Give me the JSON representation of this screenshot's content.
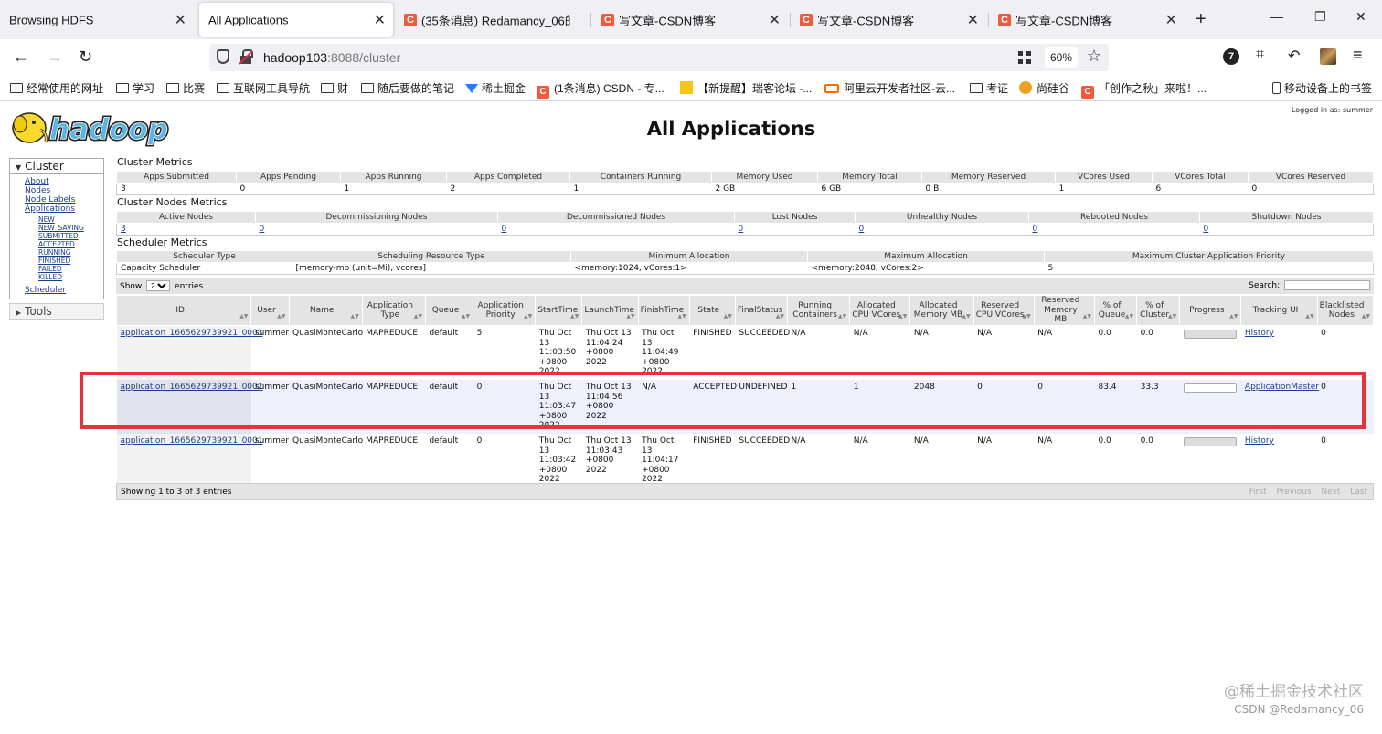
{
  "browser": {
    "tabs": [
      {
        "label": "Browsing HDFS",
        "icon": ""
      },
      {
        "label": "All Applications",
        "icon": ""
      },
      {
        "label": "(35条消息) Redamancy_06的",
        "icon": "csdn-icon"
      },
      {
        "label": "写文章-CSDN博客",
        "icon": "csdn-icon"
      },
      {
        "label": "写文章-CSDN博客",
        "icon": "csdn-icon"
      },
      {
        "label": "写文章-CSDN博客",
        "icon": "csdn-icon"
      }
    ],
    "url_host": "hadoop103",
    "url_rest": ":8088/cluster",
    "zoom": "60%",
    "ext_badge": "7",
    "bookmarks": [
      {
        "label": "经常使用的网址",
        "icon": "folder-icon"
      },
      {
        "label": "学习",
        "icon": "folder-icon"
      },
      {
        "label": "比赛",
        "icon": "folder-icon"
      },
      {
        "label": "互联网工具导航",
        "icon": "folder-icon"
      },
      {
        "label": "财",
        "icon": "folder-icon"
      },
      {
        "label": "随后要做的笔记",
        "icon": "folder-icon"
      },
      {
        "label": "稀土掘金",
        "icon": "juejin-icon"
      },
      {
        "label": "(1条消息) CSDN - 专...",
        "icon": "csdn-icon"
      },
      {
        "label": "【新提醒】瑞客论坛 -...",
        "icon": "yellow-icon"
      },
      {
        "label": "阿里云开发者社区-云...",
        "icon": "aliyun-icon"
      },
      {
        "label": "考证",
        "icon": "folder-icon"
      },
      {
        "label": "尚硅谷",
        "icon": "sgg-icon"
      },
      {
        "label": "「创作之秋」来啦！...",
        "icon": "csdn-icon"
      },
      {
        "label": "移动设备上的书签",
        "icon": "mobile-icon"
      }
    ]
  },
  "page": {
    "logo_text": "hadoop",
    "title": "All Applications",
    "logged_in": "Logged in as: summer"
  },
  "sidebar": {
    "cluster_header": "Cluster",
    "links": [
      "About",
      "Nodes",
      "Node Labels",
      "Applications"
    ],
    "app_states": [
      "NEW",
      "NEW_SAVING",
      "SUBMITTED",
      "ACCEPTED",
      "RUNNING",
      "FINISHED",
      "FAILED",
      "KILLED"
    ],
    "scheduler": "Scheduler",
    "tools_header": "Tools"
  },
  "cluster_metrics": {
    "title": "Cluster Metrics",
    "headers": [
      "Apps Submitted",
      "Apps Pending",
      "Apps Running",
      "Apps Completed",
      "Containers Running",
      "Memory Used",
      "Memory Total",
      "Memory Reserved",
      "VCores Used",
      "VCores Total",
      "VCores Reserved"
    ],
    "values": [
      "3",
      "0",
      "1",
      "2",
      "1",
      "2 GB",
      "6 GB",
      "0 B",
      "1",
      "6",
      "0"
    ]
  },
  "nodes_metrics": {
    "title": "Cluster Nodes Metrics",
    "headers": [
      "Active Nodes",
      "Decommissioning Nodes",
      "Decommissioned Nodes",
      "Lost Nodes",
      "Unhealthy Nodes",
      "Rebooted Nodes",
      "Shutdown Nodes"
    ],
    "values": [
      "3",
      "0",
      "0",
      "0",
      "0",
      "0",
      "0"
    ]
  },
  "scheduler_metrics": {
    "title": "Scheduler Metrics",
    "headers": [
      "Scheduler Type",
      "Scheduling Resource Type",
      "Minimum Allocation",
      "Maximum Allocation",
      "Maximum Cluster Application Priority"
    ],
    "values": [
      "Capacity Scheduler",
      "[memory-mb (unit=Mi), vcores]",
      "<memory:1024, vCores:1>",
      "<memory:2048, vCores:2>",
      "5"
    ]
  },
  "datatable": {
    "show_label": "Show",
    "show_value": "20",
    "entries_label": "entries",
    "search_label": "Search:",
    "info": "Showing 1 to 3 of 3 entries",
    "pager": [
      "First",
      "Previous",
      "Next",
      "Last"
    ],
    "columns": [
      "ID",
      "User",
      "Name",
      "Application Type",
      "Queue",
      "Application Priority",
      "StartTime",
      "LaunchTime",
      "FinishTime",
      "State",
      "FinalStatus",
      "Running Containers",
      "Allocated CPU VCores",
      "Allocated Memory MB",
      "Reserved CPU VCores",
      "Reserved Memory MB",
      "% of Queue",
      "% of Cluster",
      "Progress",
      "Tracking UI",
      "Blacklisted Nodes"
    ],
    "rows": [
      {
        "id": "application_1665629739921_0003",
        "user": "summer",
        "name": "QuasiMonteCarlo",
        "type": "MAPREDUCE",
        "queue": "default",
        "priority": "5",
        "start": "Thu Oct 13 11:03:50 +0800 2022",
        "launch": "Thu Oct 13 11:04:24 +0800 2022",
        "finish": "Thu Oct 13 11:04:49 +0800 2022",
        "state": "FINISHED",
        "final": "SUCCEEDED",
        "running": "N/A",
        "alloc_cpu": "N/A",
        "alloc_mem": "N/A",
        "res_cpu": "N/A",
        "res_mem": "N/A",
        "pct_queue": "0.0",
        "pct_cluster": "0.0",
        "progress": 1.0,
        "tracking": "History",
        "blacklisted": "0",
        "highlight": false
      },
      {
        "id": "application_1665629739921_0002",
        "user": "summer",
        "name": "QuasiMonteCarlo",
        "type": "MAPREDUCE",
        "queue": "default",
        "priority": "0",
        "start": "Thu Oct 13 11:03:47 +0800 2022",
        "launch": "Thu Oct 13 11:04:56 +0800 2022",
        "finish": "N/A",
        "state": "ACCEPTED",
        "final": "UNDEFINED",
        "running": "1",
        "alloc_cpu": "1",
        "alloc_mem": "2048",
        "res_cpu": "0",
        "res_mem": "0",
        "pct_queue": "83.4",
        "pct_cluster": "33.3",
        "progress": 0.0,
        "tracking": "ApplicationMaster",
        "blacklisted": "0",
        "highlight": true
      },
      {
        "id": "application_1665629739921_0001",
        "user": "summer",
        "name": "QuasiMonteCarlo",
        "type": "MAPREDUCE",
        "queue": "default",
        "priority": "0",
        "start": "Thu Oct 13 11:03:42 +0800 2022",
        "launch": "Thu Oct 13 11:03:43 +0800 2022",
        "finish": "Thu Oct 13 11:04:17 +0800 2022",
        "state": "FINISHED",
        "final": "SUCCEEDED",
        "running": "N/A",
        "alloc_cpu": "N/A",
        "alloc_mem": "N/A",
        "res_cpu": "N/A",
        "res_mem": "N/A",
        "pct_queue": "0.0",
        "pct_cluster": "0.0",
        "progress": 1.0,
        "tracking": "History",
        "blacklisted": "0",
        "highlight": false
      }
    ]
  },
  "watermark": {
    "main": "@稀土掘金技术社区",
    "sub": "CSDN @Redamancy_06"
  },
  "colors": {
    "highlight_border": "#e8313a",
    "link": "#1a3f8c",
    "header_bg": "#e4e4e4"
  }
}
